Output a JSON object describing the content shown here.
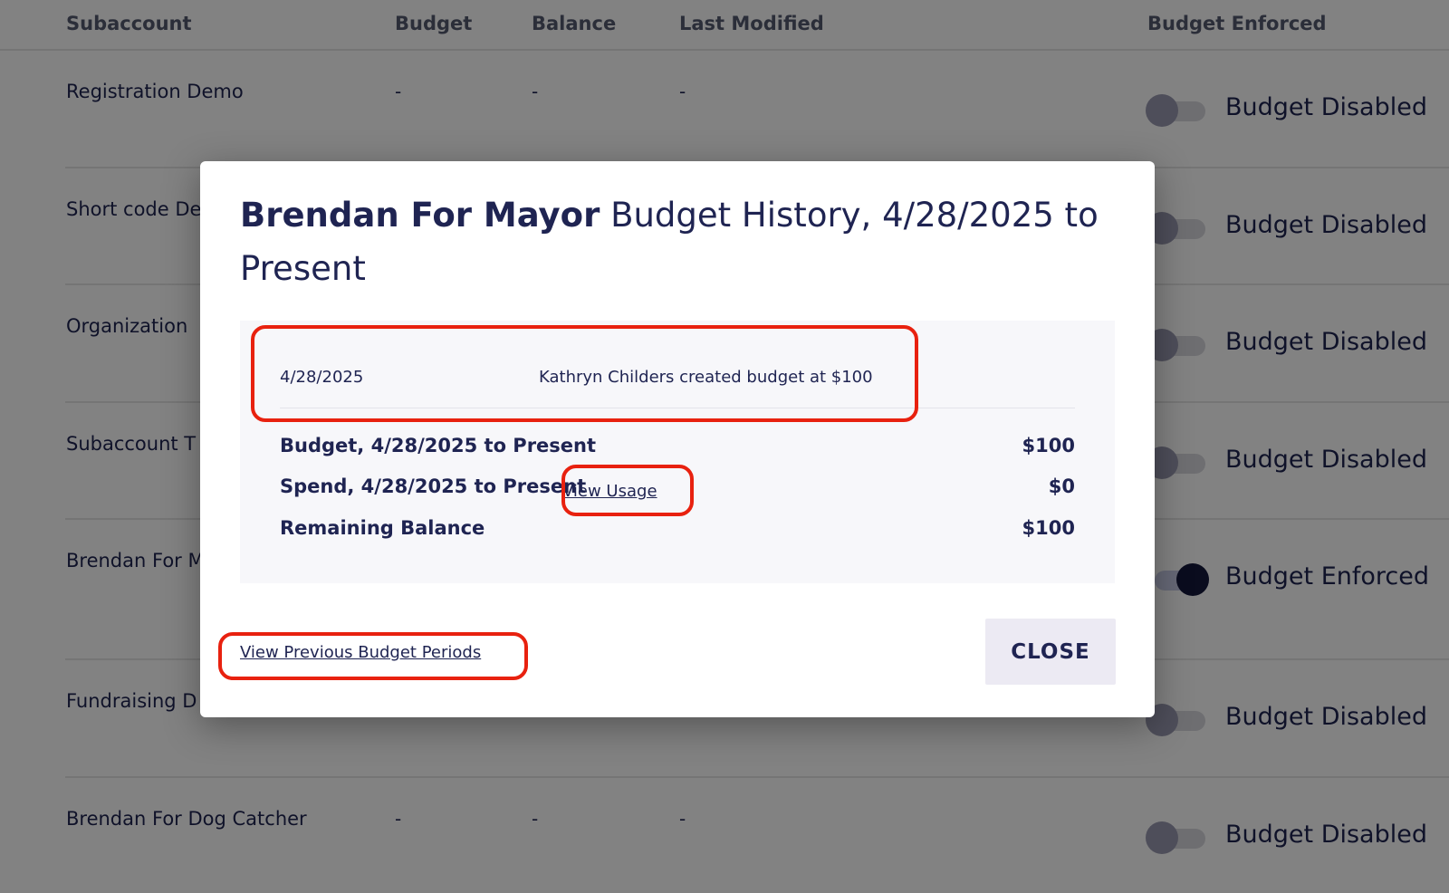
{
  "table": {
    "headers": {
      "subaccount": "Subaccount",
      "budget": "Budget",
      "balance": "Balance",
      "last_modified": "Last Modified",
      "budget_enforced": "Budget Enforced"
    },
    "rows": [
      {
        "name": "Registration Demo",
        "budget": "-",
        "balance": "-",
        "last_modified": "-",
        "enforced": false,
        "status": "Budget Disabled"
      },
      {
        "name": "Short code De",
        "budget": "",
        "balance": "",
        "last_modified": "",
        "enforced": false,
        "status": "Budget Disabled"
      },
      {
        "name": "Organization",
        "budget": "",
        "balance": "",
        "last_modified": "",
        "enforced": false,
        "status": "Budget Disabled"
      },
      {
        "name": "Subaccount T",
        "budget": "",
        "balance": "",
        "last_modified": "",
        "enforced": false,
        "status": "Budget Disabled"
      },
      {
        "name": "Brendan For M",
        "budget": "",
        "balance": "",
        "last_modified": "",
        "enforced": true,
        "status": "Budget Enforced"
      },
      {
        "name": "Fundraising D",
        "budget": "",
        "balance": "",
        "last_modified": "",
        "enforced": false,
        "status": "Budget Disabled"
      },
      {
        "name": "Brendan For Dog Catcher",
        "budget": "-",
        "balance": "-",
        "last_modified": "-",
        "enforced": false,
        "status": "Budget Disabled"
      }
    ]
  },
  "modal": {
    "title_org": "Brendan For Mayor",
    "title_rest": " Budget History, 4/28/2025 to Present",
    "history": [
      {
        "date": "4/28/2025",
        "event": "Kathryn Childers created budget at $100"
      }
    ],
    "summary": {
      "budget_label": "Budget, 4/28/2025 to Present",
      "budget_value": "$100",
      "spend_label": "Spend, 4/28/2025 to Present",
      "spend_value": "$0",
      "view_usage": "View Usage",
      "remaining_label": "Remaining Balance",
      "remaining_value": "$100"
    },
    "view_previous": "View Previous Budget Periods",
    "close_label": "CLOSE"
  },
  "colors": {
    "text": "#1f2452",
    "annotation": "#e8210f",
    "overlay": "rgba(0,0,0,0.49)",
    "close_bg": "#eceaf3"
  }
}
